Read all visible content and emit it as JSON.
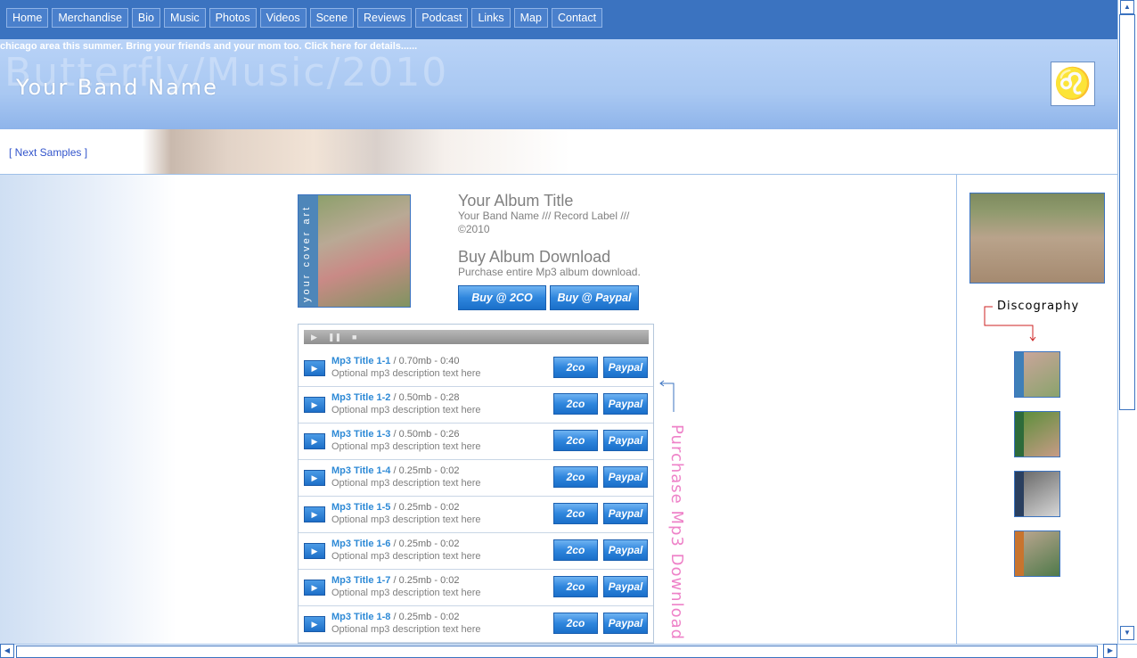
{
  "nav": {
    "items": [
      "Home",
      "Merchandise",
      "Bio",
      "Music",
      "Photos",
      "Videos",
      "Scene",
      "Reviews",
      "Podcast",
      "Links",
      "Map",
      "Contact"
    ]
  },
  "header": {
    "marquee": "chicago area this summer. Bring your friends and your mom too. Click here for details......",
    "watermark_title": "ButterflyMusic2010",
    "band_name": "Your Band Name",
    "logo_glyph": "♌"
  },
  "strip": {
    "next_samples": "[ Next Samples ]"
  },
  "album": {
    "cover_spine_text": "your cover art",
    "title": "Your Album Title",
    "subtitle": "Your Band Name /// Record Label /// ©2010",
    "buy_title": "Buy Album Download",
    "buy_sub": "Purchase entire Mp3 album download.",
    "buy_2co": "Buy @ 2CO",
    "buy_paypal": "Buy @ Paypal"
  },
  "player": {
    "play_glyph": "▶",
    "pause_glyph": "❚❚",
    "stop_glyph": "■"
  },
  "tracks": [
    {
      "title": "Mp3 Title 1-1",
      "meta": " / 0.70mb - 0:40",
      "desc": "Optional mp3 description text here",
      "btn_2co": "2co",
      "btn_paypal": "Paypal"
    },
    {
      "title": "Mp3 Title 1-2",
      "meta": " / 0.50mb - 0:28",
      "desc": "Optional mp3 description text here",
      "btn_2co": "2co",
      "btn_paypal": "Paypal"
    },
    {
      "title": "Mp3 Title 1-3",
      "meta": " / 0.50mb - 0:26",
      "desc": "Optional mp3 description text here",
      "btn_2co": "2co",
      "btn_paypal": "Paypal"
    },
    {
      "title": "Mp3 Title 1-4",
      "meta": " / 0.25mb - 0:02",
      "desc": "Optional mp3 description text here",
      "btn_2co": "2co",
      "btn_paypal": "Paypal"
    },
    {
      "title": "Mp3 Title 1-5",
      "meta": " / 0.25mb - 0:02",
      "desc": "Optional mp3 description text here",
      "btn_2co": "2co",
      "btn_paypal": "Paypal"
    },
    {
      "title": "Mp3 Title 1-6",
      "meta": " / 0.25mb - 0:02",
      "desc": "Optional mp3 description text here",
      "btn_2co": "2co",
      "btn_paypal": "Paypal"
    },
    {
      "title": "Mp3 Title 1-7",
      "meta": " / 0.25mb - 0:02",
      "desc": "Optional mp3 description text here",
      "btn_2co": "2co",
      "btn_paypal": "Paypal"
    },
    {
      "title": "Mp3 Title 1-8",
      "meta": " / 0.25mb - 0:02",
      "desc": "Optional mp3 description text here",
      "btn_2co": "2co",
      "btn_paypal": "Paypal"
    }
  ],
  "purchase_label": "Purchase Mp3 Download",
  "sidebar": {
    "discography_label": "Discography",
    "thumbs": [
      {
        "spine_color": "#3f7fb8",
        "colors": [
          "#c9a59a",
          "#8aa36c"
        ]
      },
      {
        "spine_color": "#2d6b3a",
        "colors": [
          "#5e8f3c",
          "#c79b86"
        ]
      },
      {
        "spine_color": "#2a3f5f",
        "colors": [
          "#6b6b6b",
          "#d7d7d7"
        ]
      },
      {
        "spine_color": "#c8742e",
        "colors": [
          "#b7a48d",
          "#4f7a4a"
        ]
      }
    ]
  },
  "colors": {
    "nav_bg": "#3b73c0",
    "accent_blue": "#2e8ad6",
    "purchase_pink": "#ee82c8",
    "disco_arrow_red": "#cc2222"
  }
}
